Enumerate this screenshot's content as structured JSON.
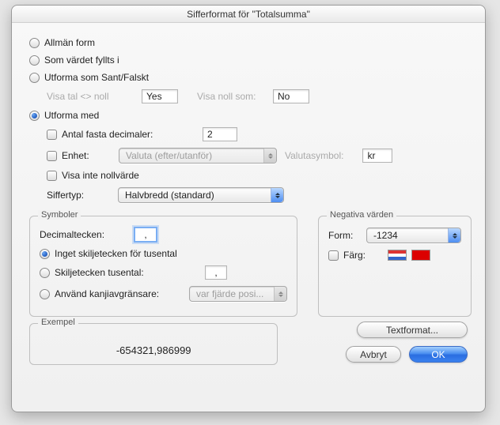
{
  "title": "Sifferformat för \"Totalsumma\"",
  "radios": {
    "allman": "Allmän form",
    "som_vardet": "Som värdet fyllts i",
    "sant_falskt": "Utforma som Sant/Falskt",
    "utforma_med": "Utforma med"
  },
  "sant_falskt": {
    "visa_tal_label": "Visa tal <> noll",
    "visa_tal_value": "Yes",
    "visa_noll_label": "Visa noll som:",
    "visa_noll_value": "No"
  },
  "utforma": {
    "antal_decimaler": "Antal fasta decimaler:",
    "antal_value": "2",
    "enhet": "Enhet:",
    "enhet_popup": "Valuta (efter/utanför)",
    "valutasymbol_label": "Valutasymbol:",
    "valutasymbol_value": "kr",
    "visa_inte_noll": "Visa inte nollvärde",
    "siffertyp": "Siffertyp:",
    "siffertyp_popup": "Halvbredd (standard)"
  },
  "symboler": {
    "legend": "Symboler",
    "decimaltecken": "Decimaltecken:",
    "decimaltecken_value": ",",
    "inget": "Inget skiljetecken för tusental",
    "skiljetecken": "Skiljetecken tusental:",
    "skiljetecken_value": ",",
    "kanji": "Använd kanjiavgränsare:",
    "kanji_popup": "var fjärde posi..."
  },
  "negativa": {
    "legend": "Negativa värden",
    "form": "Form:",
    "form_popup": "-1234",
    "farg": "Färg:"
  },
  "exempel": {
    "legend": "Exempel",
    "value": "-654321,986999"
  },
  "buttons": {
    "textformat": "Textformat...",
    "avbryt": "Avbryt",
    "ok": "OK"
  }
}
